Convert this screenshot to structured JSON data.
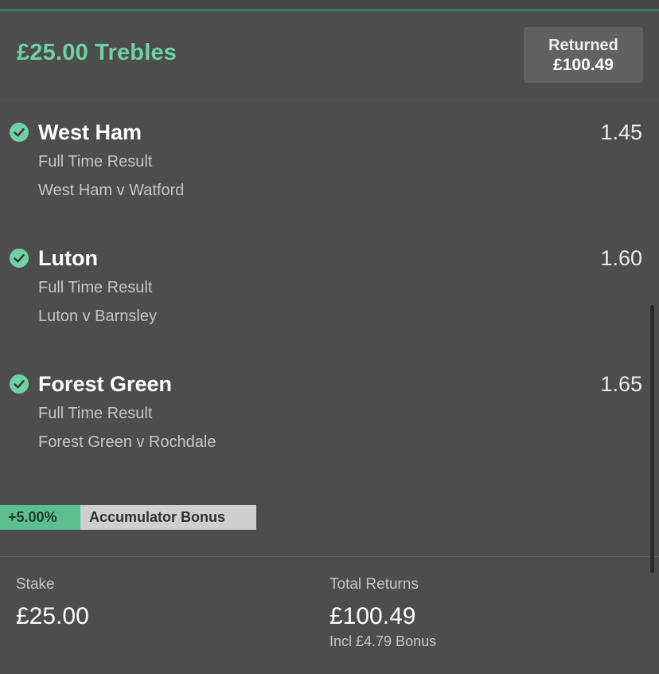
{
  "header": {
    "title": "£25.00 Trebles",
    "returned_label": "Returned",
    "returned_amount": "£100.49"
  },
  "selections": [
    {
      "name": "West Ham",
      "odds": "1.45",
      "market": "Full Time Result",
      "event": "West Ham v Watford",
      "status_icon": "check-circle-icon"
    },
    {
      "name": "Luton",
      "odds": "1.60",
      "market": "Full Time Result",
      "event": "Luton v Barnsley",
      "status_icon": "check-circle-icon"
    },
    {
      "name": "Forest Green",
      "odds": "1.65",
      "market": "Full Time Result",
      "event": "Forest Green v Rochdale",
      "status_icon": "check-circle-icon"
    }
  ],
  "bonus": {
    "percent": "+5.00%",
    "label": "Accumulator Bonus"
  },
  "summary": {
    "stake_label": "Stake",
    "stake_value": "£25.00",
    "returns_label": "Total Returns",
    "returns_value": "£100.49",
    "returns_note": "Incl £4.79 Bonus"
  },
  "colors": {
    "background": "#4d4d4d",
    "accent_green": "#6fd2a6",
    "bonus_green": "#5bbf8f",
    "badge_grey": "#616161"
  }
}
